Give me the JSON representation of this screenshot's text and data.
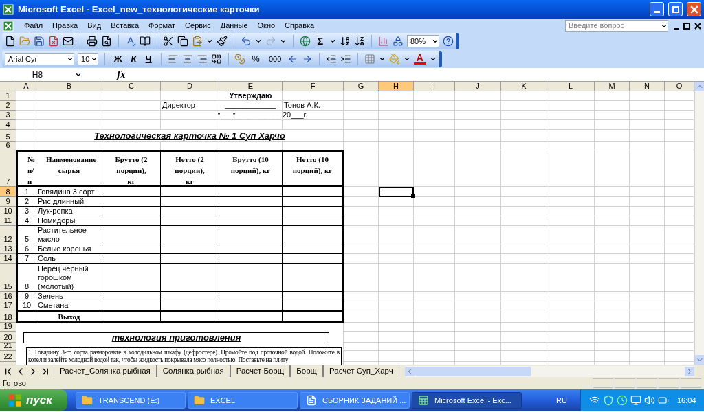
{
  "window": {
    "title": "Microsoft Excel - Excel_new_технологические карточки"
  },
  "menu": [
    "Файл",
    "Правка",
    "Вид",
    "Вставка",
    "Формат",
    "Сервис",
    "Данные",
    "Окно",
    "Справка"
  ],
  "help_search": {
    "placeholder": "Введите вопрос"
  },
  "standard_toolbar": {
    "sum": "Σ",
    "zoom": "80%"
  },
  "format_toolbar": {
    "font": "Arial Cyr",
    "size": "10",
    "bold": "Ж",
    "italic": "К",
    "underline": "Ч",
    "percent": "%",
    "thousands": "000",
    "font_color": "A"
  },
  "formula_bar": {
    "name_box": "H8",
    "fx": "fx"
  },
  "sheet": {
    "columns": [
      {
        "label": "A",
        "selected": false
      },
      {
        "label": "B",
        "selected": false
      },
      {
        "label": "C",
        "selected": false
      },
      {
        "label": "D",
        "selected": false
      },
      {
        "label": "E",
        "selected": false
      },
      {
        "label": "F",
        "selected": false
      },
      {
        "label": "G",
        "selected": false
      },
      {
        "label": "H",
        "selected": true
      },
      {
        "label": "I",
        "selected": false
      },
      {
        "label": "J",
        "selected": false
      },
      {
        "label": "K",
        "selected": false
      },
      {
        "label": "L",
        "selected": false
      },
      {
        "label": "M",
        "selected": false
      },
      {
        "label": "N",
        "selected": false
      },
      {
        "label": "O",
        "selected": false
      }
    ],
    "rows": [
      {
        "label": "1",
        "selected": false
      },
      {
        "label": "2",
        "selected": false
      },
      {
        "label": "3",
        "selected": false
      },
      {
        "label": "4",
        "selected": false
      },
      {
        "label": "5",
        "selected": false
      },
      {
        "label": "6",
        "selected": false
      },
      {
        "label": "7",
        "selected": false
      },
      {
        "label": "8",
        "selected": true
      },
      {
        "label": "9",
        "selected": false
      },
      {
        "label": "10",
        "selected": false
      },
      {
        "label": "11",
        "selected": false
      },
      {
        "label": "12",
        "selected": false
      },
      {
        "label": "13",
        "selected": false
      },
      {
        "label": "14",
        "selected": false
      },
      {
        "label": "15",
        "selected": false
      },
      {
        "label": "16",
        "selected": false
      },
      {
        "label": "17",
        "selected": false
      },
      {
        "label": "18",
        "selected": false
      },
      {
        "label": "19",
        "selected": false
      },
      {
        "label": "20",
        "selected": false
      },
      {
        "label": "21",
        "selected": false
      },
      {
        "label": "22",
        "selected": false
      }
    ]
  },
  "approval": {
    "title": "Утверждаю",
    "position": "Директор",
    "signature_line": "____________",
    "name": "Тонов А.К.",
    "date_day": "\"___\"___________",
    "date_year": "20___г."
  },
  "card_title": "Технологическая карточка № 1 Суп Харчо",
  "table": {
    "columns": [
      "№ п/п",
      "Наименование сырья",
      "Брутто (2 порции), кг",
      "Нетто (2 порции), кг",
      "Брутто (10 порций), кг",
      "Нетто (10 порций), кг"
    ],
    "rows": [
      {
        "number": "1",
        "name": "Говядина 3 сорт"
      },
      {
        "number": "2",
        "name": "Рис длинный"
      },
      {
        "number": "3",
        "name": "Лук-репка"
      },
      {
        "number": "4",
        "name": "Помидоры"
      },
      {
        "number": "5",
        "name": "Растительное масло"
      },
      {
        "number": "6",
        "name": "Белые коренья"
      },
      {
        "number": "7",
        "name": "Соль"
      },
      {
        "number": "8",
        "name": "Перец черный горошком (молотый)"
      },
      {
        "number": "9",
        "name": "Зелень"
      },
      {
        "number": "10",
        "name": "Сметана"
      }
    ],
    "total": "Выход"
  },
  "recipe": {
    "heading": "технология приготовления",
    "text": "1. Говядину 3-го сорта разморозьте в холодильном шкафу (дефростере). Промойте под проточной водой. Положите в котел и залейте холодной водой так, чтобы жидкость покрывала мясо полностью. Поставьте на плиту"
  },
  "sheet_tabs": [
    {
      "label": "Расчет_Солянка рыбная",
      "selected": false
    },
    {
      "label": "Солянка рыбная",
      "selected": false
    },
    {
      "label": "Расчет Борщ",
      "selected": false
    },
    {
      "label": "Борщ",
      "selected": false
    },
    {
      "label": "Расчет Суп_Харч",
      "selected": false
    }
  ],
  "status_bar": {
    "text": "Готово"
  },
  "taskbar": {
    "start": "пуск",
    "tasks": [
      {
        "label": "TRANSCEND (E:)",
        "kind": "folder",
        "selected": false
      },
      {
        "label": "EXCEL",
        "kind": "folder",
        "selected": false
      },
      {
        "label": "СБОРНИК ЗАДАНИЙ ...",
        "kind": "document",
        "selected": false
      },
      {
        "label": "Microsoft Excel - Exc...",
        "kind": "spreadsheet",
        "selected": true
      }
    ],
    "language": "RU",
    "clock": "16:04"
  }
}
